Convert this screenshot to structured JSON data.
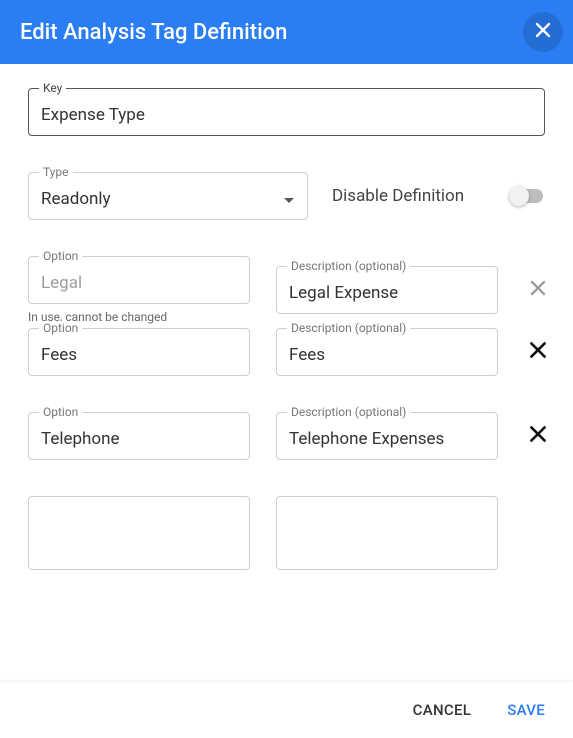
{
  "header": {
    "title": "Edit Analysis Tag Definition"
  },
  "fields": {
    "key": {
      "label": "Key",
      "value": "Expense Type"
    },
    "type": {
      "label": "Type",
      "value": "Readonly"
    },
    "disable": {
      "label": "Disable Definition",
      "on": false
    }
  },
  "labels": {
    "option": "Option",
    "description": "Description (optional)",
    "in_use": "In use, cannot be changed"
  },
  "options": [
    {
      "option": "Legal",
      "description": "Legal Expense",
      "locked": true
    },
    {
      "option": "Fees",
      "description": "Fees",
      "locked": false
    },
    {
      "option": "Telephone",
      "description": "Telephone Expenses",
      "locked": false
    }
  ],
  "footer": {
    "cancel": "CANCEL",
    "save": "SAVE"
  }
}
